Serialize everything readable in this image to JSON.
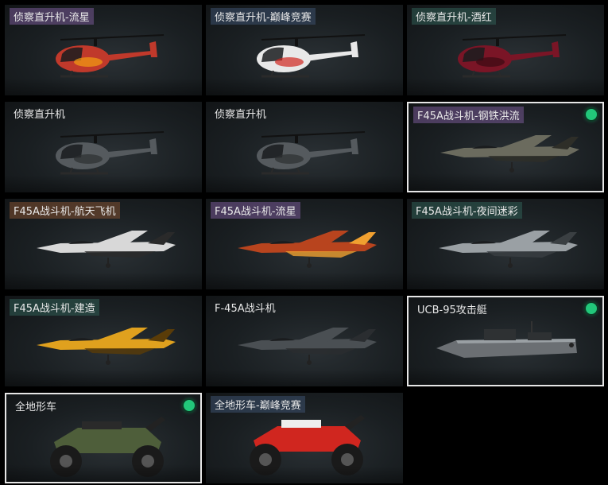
{
  "items": [
    {
      "label": "侦察直升机-流星",
      "tag": "purple",
      "kind": "heli",
      "color": "#c0392b",
      "accent": "#f39c12",
      "selected": false
    },
    {
      "label": "侦察直升机-巅峰竞赛",
      "tag": "blue",
      "kind": "heli",
      "color": "#e8e8e8",
      "accent": "#d0261f",
      "selected": false
    },
    {
      "label": "侦察直升机-酒红",
      "tag": "green",
      "kind": "heli",
      "color": "#7a1526",
      "accent": "#3a0a12",
      "selected": false
    },
    {
      "label": "侦察直升机",
      "tag": "none",
      "kind": "heli",
      "color": "#555a5e",
      "accent": "#2c2f31",
      "selected": false
    },
    {
      "label": "侦察直升机",
      "tag": "none",
      "kind": "heli",
      "color": "#555a5e",
      "accent": "#2c2f31",
      "selected": false
    },
    {
      "label": "F45A战斗机-钢铁洪流",
      "tag": "purple",
      "kind": "jet",
      "color": "#6b6b5e",
      "accent": "#2e2e28",
      "selected": true
    },
    {
      "label": "F45A战斗机-航天飞机",
      "tag": "orange",
      "kind": "jet",
      "color": "#d8d8d8",
      "accent": "#2a2a2a",
      "selected": false
    },
    {
      "label": "F45A战斗机-流星",
      "tag": "purple",
      "kind": "jet",
      "color": "#b8441e",
      "accent": "#f0a030",
      "selected": false
    },
    {
      "label": "F45A战斗机-夜间迷彩",
      "tag": "green",
      "kind": "jet",
      "color": "#9aa0a4",
      "accent": "#3a3f42",
      "selected": false
    },
    {
      "label": "F45A战斗机-建造",
      "tag": "green",
      "kind": "jet",
      "color": "#e0a11e",
      "accent": "#5a3c08",
      "selected": false
    },
    {
      "label": "F-45A战斗机",
      "tag": "none",
      "kind": "jet",
      "color": "#4a4f53",
      "accent": "#2a2d30",
      "selected": false
    },
    {
      "label": "UCB-95攻击艇",
      "tag": "none",
      "kind": "boat",
      "color": "#6b6f73",
      "accent": "#2e3133",
      "selected": true
    },
    {
      "label": "全地形车",
      "tag": "none",
      "kind": "atv",
      "color": "#4e5e3a",
      "accent": "#2a2a2a",
      "selected": true
    },
    {
      "label": "全地形车-巅峰竞赛",
      "tag": "blue",
      "kind": "atv",
      "color": "#d0261f",
      "accent": "#eeeeee",
      "selected": false
    }
  ]
}
